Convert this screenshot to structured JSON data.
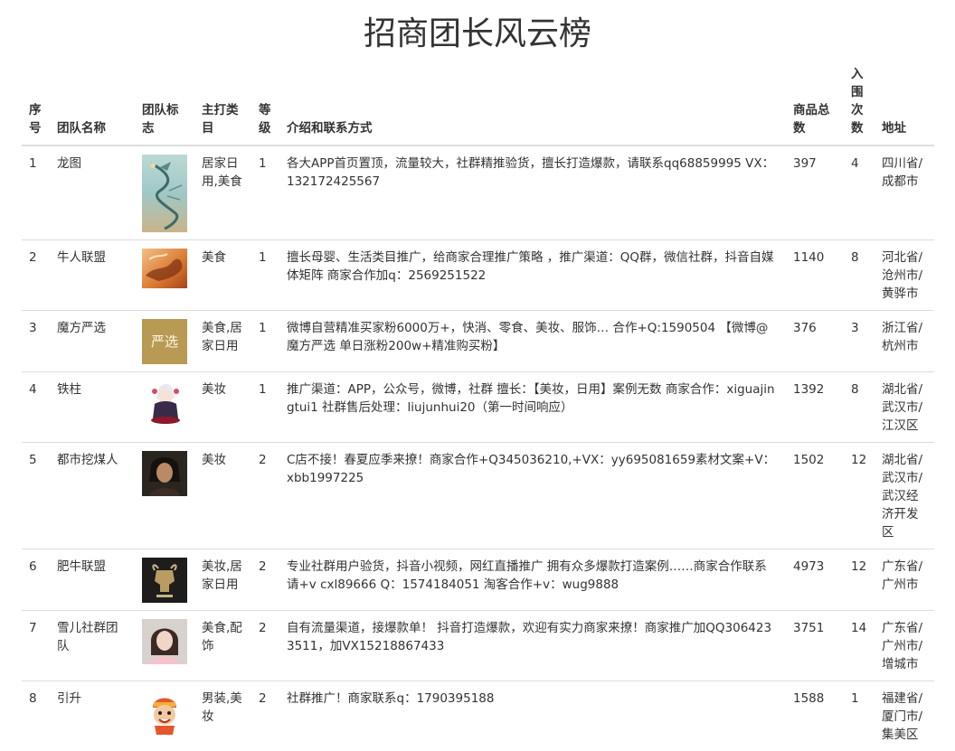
{
  "page": {
    "title": "招商团长风云榜"
  },
  "table": {
    "headers": {
      "index": "序号",
      "name": "团队名称",
      "logo": "团队标志",
      "category": "主打类目",
      "level": "等级",
      "intro": "介绍和联系方式",
      "goods": "商品总数",
      "entries": "入围次数",
      "address": "地址"
    },
    "rows": [
      {
        "index": "1",
        "name": "龙图",
        "logo_icon": "dragon-painting-icon",
        "category": "居家日用,美食",
        "level": "1",
        "intro": "各大APP首页置顶，流量较大，社群精推验货，擅长打造爆款，请联系qq68859995 VX：132172425567",
        "goods": "397",
        "entries": "4",
        "address": "四川省/成都市"
      },
      {
        "index": "2",
        "name": "牛人联盟",
        "logo_icon": "dragon-fire-icon",
        "category": "美食",
        "level": "1",
        "intro": "擅长母婴、生活类目推广，给商家合理推广策略 ，推广渠道：QQ群，微信社群，抖音自媒体矩阵 商家合作加q：2569251522",
        "goods": "1140",
        "entries": "8",
        "address": "河北省/沧州市/黄骅市"
      },
      {
        "index": "3",
        "name": "魔方严选",
        "logo_icon": "brand-text-icon",
        "logo_text": "严选",
        "category": "美食,居家日用",
        "level": "1",
        "intro": "微博自营精准买家粉6000万+，快消、零食、美妆、服饰… 合作+Q:1590504 【微博@魔方严选 单日涨粉200w+精准购买粉】",
        "goods": "376",
        "entries": "3",
        "address": "浙江省/杭州市"
      },
      {
        "index": "4",
        "name": "铁柱",
        "logo_icon": "anime-character-icon",
        "category": "美妆",
        "level": "1",
        "intro": "推广渠道：APP，公众号，微博，社群 擅长：【美妆，日用】案例无数 商家合作：xiguajingtui1 社群售后处理：liujunhui20（第一时间响应）",
        "goods": "1392",
        "entries": "8",
        "address": "湖北省/武汉市/江汉区"
      },
      {
        "index": "5",
        "name": "都市挖煤人",
        "logo_icon": "portrait-photo-icon",
        "category": "美妆",
        "level": "2",
        "intro": "C店不接！春夏应季来撩！商家合作+Q345036210,+VX：yy695081659素材文案+V：xbb1997225",
        "goods": "1502",
        "entries": "12",
        "address": "湖北省/武汉市/武汉经济开发区"
      },
      {
        "index": "6",
        "name": "肥牛联盟",
        "logo_icon": "bull-emblem-icon",
        "category": "美妆,居家日用",
        "level": "2",
        "intro": "专业社群用户验货，抖音小视频，网红直播推广 拥有众多爆款打造案例……商家合作联系请+v cxl89666 Q：1574184051 淘客合作+v：wug9888",
        "goods": "4973",
        "entries": "12",
        "address": "广东省/广州市"
      },
      {
        "index": "7",
        "name": "雪儿社群团队",
        "logo_icon": "girl-portrait-icon",
        "category": "美食,配饰",
        "level": "2",
        "intro": "自有流量渠道，接爆款单！ 抖音打造爆款，欢迎有实力商家来撩！商家推广加QQ3064233511，加VX15218867433",
        "goods": "3751",
        "entries": "14",
        "address": "广东省/广州市/增城市"
      },
      {
        "index": "8",
        "name": "引升",
        "logo_icon": "cartoon-monk-icon",
        "category": "男装,美妆",
        "level": "2",
        "intro": "社群推广！商家联系q：1790395188",
        "goods": "1588",
        "entries": "1",
        "address": "福建省/厦门市/集美区"
      }
    ]
  }
}
